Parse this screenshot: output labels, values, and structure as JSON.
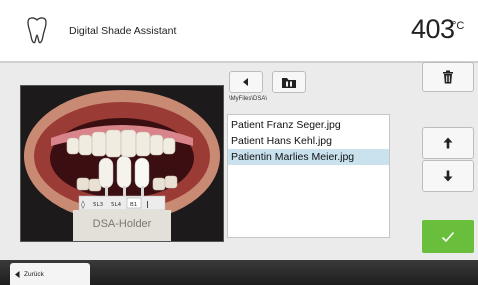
{
  "header": {
    "title": "Digital Shade Assistant",
    "temperature_value": "403",
    "temperature_unit": "°C",
    "app_icon": "tooth-icon"
  },
  "toolbar": {
    "back_icon": "triangle-left-icon",
    "folder_icon": "folder-icon",
    "path": "\\MyFiles\\DSA\\"
  },
  "photo": {
    "holder_label": "DSA-Holder",
    "shade_tabs": [
      "5L3",
      "5L4",
      "B1"
    ]
  },
  "file_list": {
    "items": [
      {
        "label": "Patient Franz Seger.jpg",
        "selected": false
      },
      {
        "label": "Patient Hans Kehl.jpg",
        "selected": false
      },
      {
        "label": "Patientin Marlies Meier.jpg",
        "selected": true
      }
    ]
  },
  "side_buttons": {
    "delete_icon": "trash-icon",
    "up_icon": "arrow-up-icon",
    "down_icon": "arrow-down-icon",
    "confirm_icon": "checkmark-icon"
  },
  "footer": {
    "back_label": "Zurück"
  },
  "colors": {
    "confirm_green": "#69be3c",
    "selected_row": "#c9e2ee",
    "footer_bar": "#2b2b2b",
    "panel_bg": "#ebebeb"
  }
}
